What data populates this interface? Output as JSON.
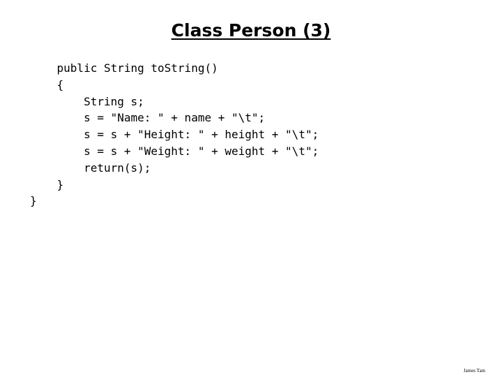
{
  "slide": {
    "title": "Class Person  (3)",
    "code_lines": [
      "    public String toString()",
      "    {",
      "        String s;",
      "        s = \"Name: \" + name + \"\\t\";",
      "        s = s + \"Height: \" + height + \"\\t\";",
      "        s = s + \"Weight: \" + weight + \"\\t\";",
      "        return(s);",
      "    }",
      "}"
    ],
    "footer": "James Tam"
  }
}
